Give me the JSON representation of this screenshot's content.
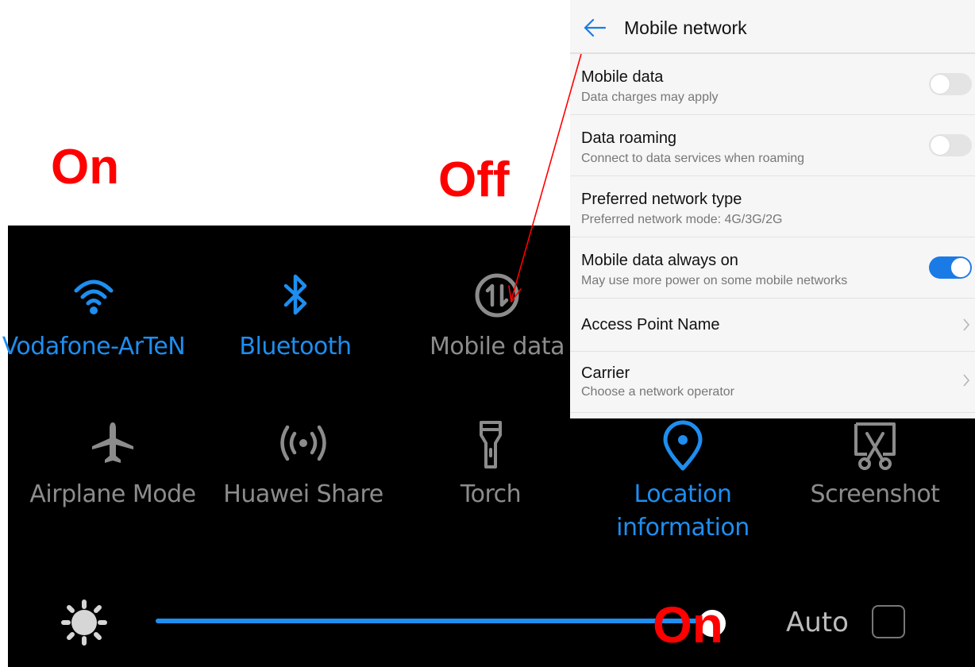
{
  "annotations": {
    "on_top": "On",
    "off": "Off",
    "on_bottom": "On",
    "color": "#ff0000"
  },
  "quick_settings": {
    "tiles": [
      {
        "label": "Vodafone-ArTeN",
        "icon": "wifi-icon",
        "active": true
      },
      {
        "label": "Bluetooth",
        "icon": "bluetooth-icon",
        "active": true
      },
      {
        "label": "Mobile data",
        "icon": "mobile-data-icon",
        "active": false
      },
      {
        "label": "Airplane Mode",
        "icon": "airplane-icon",
        "active": false
      },
      {
        "label": "Huawei Share",
        "icon": "huawei-share-icon",
        "active": false
      },
      {
        "label": "Torch",
        "icon": "torch-icon",
        "active": false
      },
      {
        "label": "Location information",
        "icon": "location-pin-icon",
        "active": true
      },
      {
        "label": "Screenshot",
        "icon": "screenshot-icon",
        "active": false
      }
    ],
    "location_lines": [
      "Location",
      "information"
    ],
    "brightness": {
      "level": 0.95,
      "auto_label": "Auto",
      "auto_checked": false
    },
    "colors": {
      "active": "#1e8ef0",
      "inactive": "#8c8c8c",
      "background": "#000000"
    }
  },
  "mobile_network": {
    "title": "Mobile network",
    "rows": [
      {
        "title": "Mobile data",
        "subtitle": "Data charges may apply",
        "control": "switch",
        "on": false
      },
      {
        "title": "Data roaming",
        "subtitle": "Connect to data services when roaming",
        "control": "switch",
        "on": false
      },
      {
        "title": "Preferred network type",
        "subtitle": "Preferred network mode: 4G/3G/2G",
        "control": "none"
      },
      {
        "title": "Mobile data always on",
        "subtitle": "May use more power on some mobile networks",
        "control": "switch",
        "on": true
      },
      {
        "title": "Access Point Name",
        "subtitle": "",
        "control": "chevron"
      },
      {
        "title": "Carrier",
        "subtitle": "Choose a network operator",
        "control": "chevron"
      }
    ],
    "accent": "#1a7be6"
  }
}
